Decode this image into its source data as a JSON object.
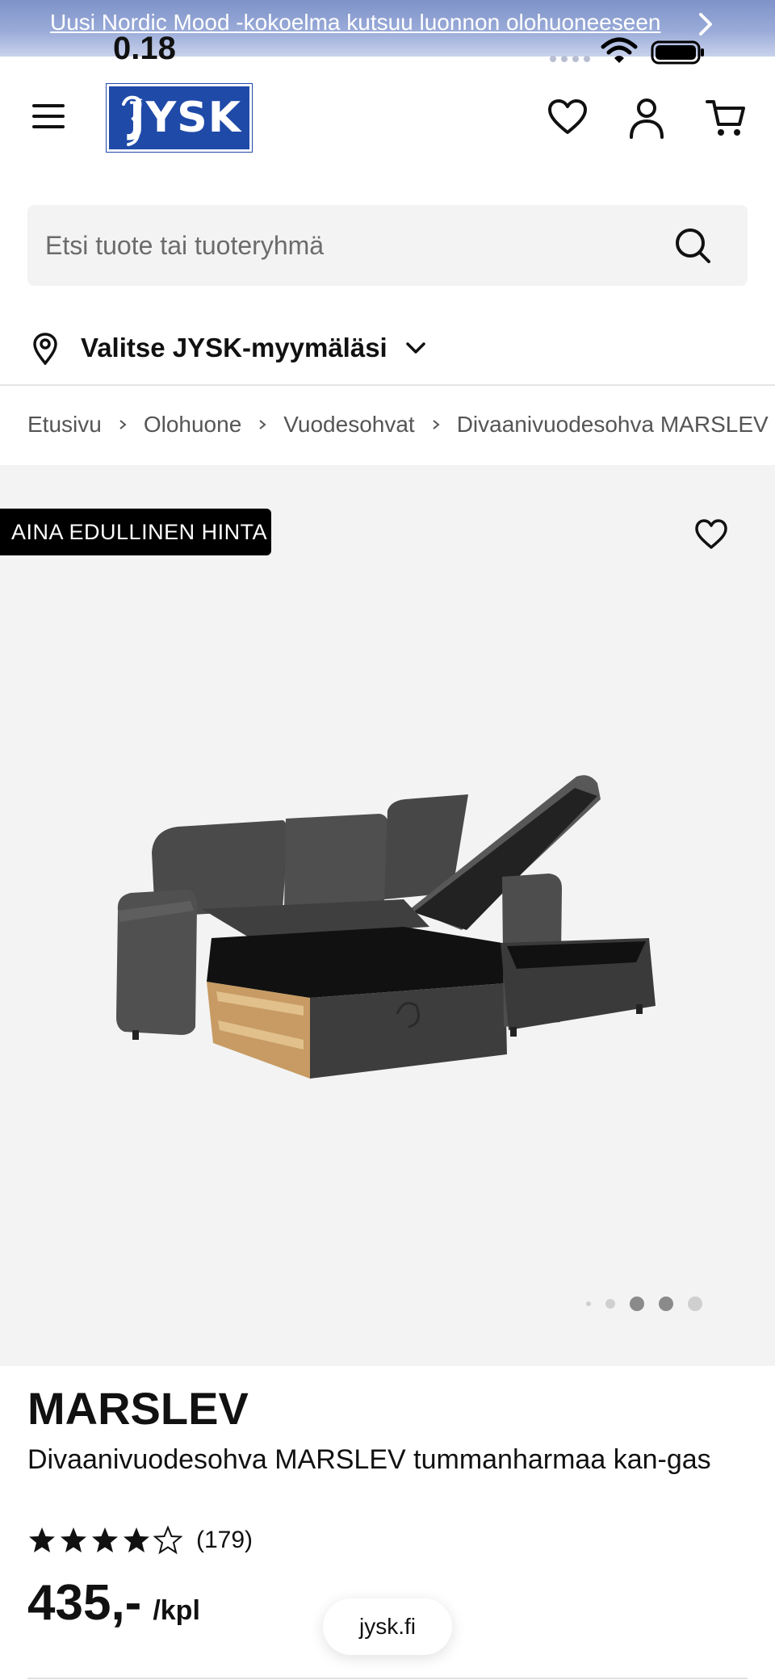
{
  "banner": {
    "text": "Uusi Nordic Mood -kokoelma kutsuu luonnon olohuoneeseen"
  },
  "status_bar": {
    "time": "0.18"
  },
  "header": {
    "logo_text": "JYSK",
    "icons": [
      "menu-icon",
      "heart-icon",
      "account-icon",
      "cart-icon"
    ]
  },
  "search": {
    "placeholder": "Etsi tuote tai tuoteryhmä"
  },
  "store": {
    "label": "Valitse JYSK-myymäläsi"
  },
  "breadcrumb": [
    "Etusivu",
    "Olohuone",
    "Vuodesohvat",
    "Divaanivuodesohva MARSLEV"
  ],
  "gallery": {
    "badge": "AINA EDULLINEN HINTA",
    "image_count": 5,
    "active_index": 2
  },
  "product": {
    "brand": "MARSLEV",
    "description": "Divaanivuodesohva MARSLEV tummanharmaa kan-gas",
    "rating": 4,
    "rating_max": 5,
    "review_count": "(179)",
    "price": "435,-",
    "unit": "/kpl"
  },
  "browser": {
    "url": "jysk.fi"
  },
  "colors": {
    "brand_blue": "#1f4aa8",
    "badge_bg": "#000000",
    "gallery_bg": "#f3f3f3"
  }
}
